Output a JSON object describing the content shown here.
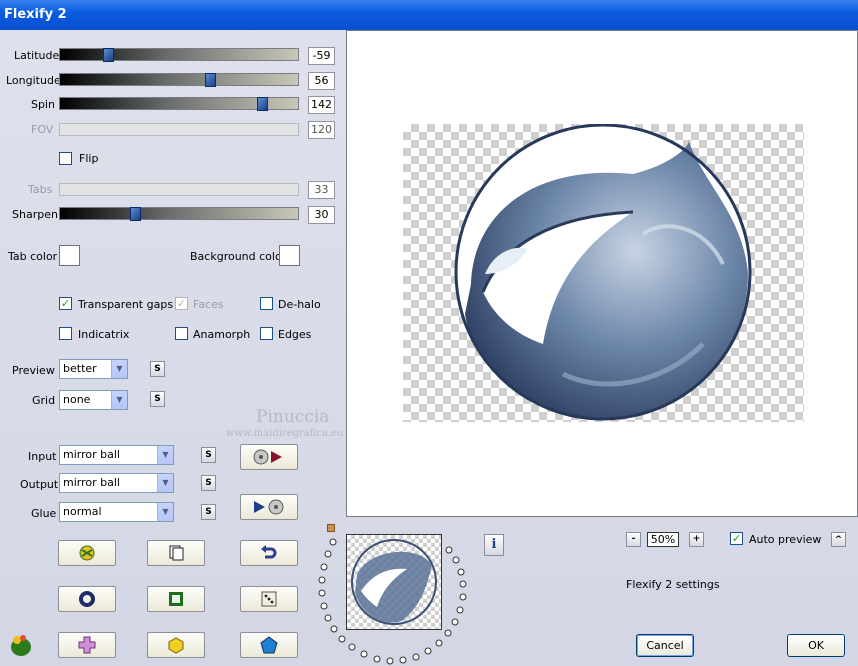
{
  "window": {
    "title": "Flexify 2"
  },
  "sliders": [
    {
      "label": "Latitude",
      "value": "-59",
      "level": 0.19,
      "enabled": true
    },
    {
      "label": "Longitude",
      "value": "56",
      "level": 0.64,
      "enabled": true
    },
    {
      "label": "Spin",
      "value": "142",
      "level": 0.87,
      "enabled": true
    },
    {
      "label": "FOV",
      "value": "120",
      "enabled": false
    },
    {
      "label": "Tabs",
      "value": "33",
      "enabled": false
    },
    {
      "label": "Sharpen",
      "value": "30",
      "level": 0.31,
      "enabled": true
    }
  ],
  "flip": {
    "label": "Flip",
    "checked": false
  },
  "colors": {
    "tab_label": "Tab color",
    "background_label": "Background color",
    "tab_value": "#ffffff",
    "background_value": "#ffffff"
  },
  "options": {
    "transparent_gaps": {
      "label": "Transparent gaps",
      "checked": true
    },
    "faces": {
      "label": "Faces",
      "checked": true,
      "enabled": false
    },
    "de_halo": {
      "label": "De-halo",
      "checked": false
    },
    "indicatrix": {
      "label": "Indicatrix",
      "checked": false
    },
    "anamorph": {
      "label": "Anamorph",
      "checked": false
    },
    "edges": {
      "label": "Edges",
      "checked": false
    }
  },
  "preview_select": {
    "label": "Preview",
    "value": "better"
  },
  "grid_select": {
    "label": "Grid",
    "value": "none"
  },
  "input_select": {
    "label": "Input",
    "value": "mirror ball"
  },
  "output_select": {
    "label": "Output",
    "value": "mirror ball"
  },
  "glue_select": {
    "label": "Glue",
    "value": "normal"
  },
  "s_button_label": "S",
  "watermark": {
    "name": "Pinuccia",
    "url": "www.maidiregrafica.eu"
  },
  "zoom": {
    "value": "50%",
    "minus": "-",
    "plus": "+"
  },
  "auto_preview": {
    "label": "Auto preview",
    "checked": true,
    "toggle": "^"
  },
  "settings_label": "Flexify 2 settings",
  "buttons": {
    "cancel": "Cancel",
    "ok": "OK",
    "info": "i"
  },
  "accent": "#0b5ce0"
}
